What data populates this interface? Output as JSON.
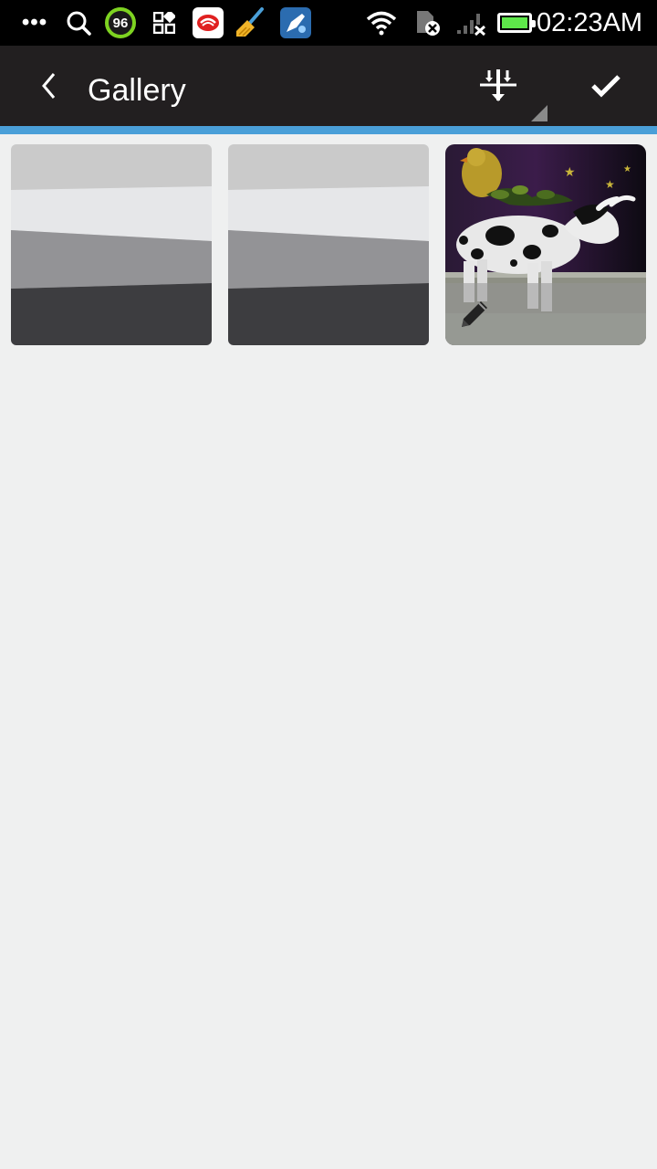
{
  "status_bar": {
    "overflow_dots": "•••",
    "badge_value": "96",
    "time": "02:23AM",
    "icons": [
      "search-icon",
      "apps-grid-icon",
      "app-red-icon",
      "broom-icon",
      "app-blue-icon",
      "wifi-icon",
      "sim-blocked-icon",
      "signal-icon",
      "battery-icon"
    ],
    "colors": {
      "badge_ring": "#7ed321",
      "battery_fill": "#5ee84a"
    }
  },
  "app_bar": {
    "title": "Gallery",
    "back_icon": "back-chevron-icon",
    "sort_icon": "sort-merge-icon",
    "confirm_icon": "check-icon",
    "colors": {
      "background": "#221f20",
      "accent": "#4a9fd8"
    }
  },
  "gallery": {
    "items": [
      {
        "type": "placeholder-image"
      },
      {
        "type": "placeholder-image"
      },
      {
        "type": "photo",
        "subject": "cow-figurine",
        "editable": true,
        "edit_icon": "pencil-icon"
      }
    ]
  }
}
